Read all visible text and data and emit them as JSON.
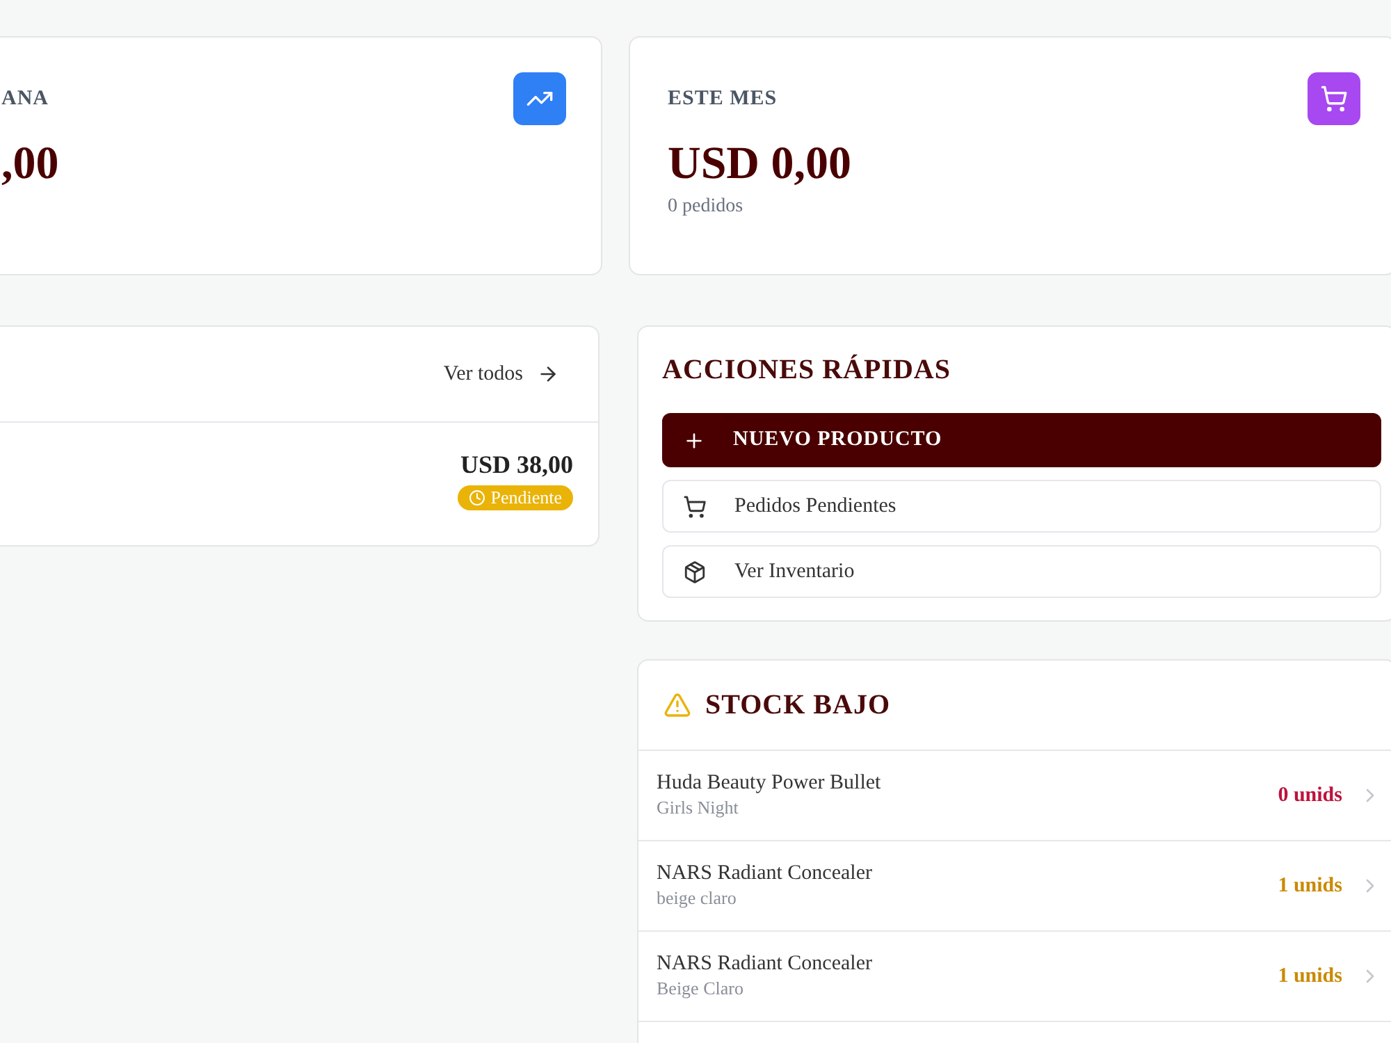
{
  "stats": [
    {
      "label": "ANA",
      "amount": ",00"
    },
    {
      "label": "ESTE MES",
      "amount": "USD 0,00",
      "note": "0 pedidos"
    }
  ],
  "recent_orders": {
    "link": "Ver todos",
    "orders": [
      {
        "total": "USD 38,00",
        "status": "Pendiente"
      }
    ]
  },
  "quick_actions": {
    "title": "ACCIONES RÁPIDAS",
    "actions": [
      {
        "label": "NUEVO PRODUCTO",
        "kind": "primary"
      },
      {
        "label": "Pedidos Pendientes",
        "kind": "secondary"
      },
      {
        "label": "Ver Inventario",
        "kind": "secondary"
      }
    ]
  },
  "low_stock": {
    "title": "STOCK BAJO",
    "items": [
      {
        "name": "Huda Beauty Power Bullet",
        "variant": "Girls Night",
        "quantity": "0 unids",
        "color": "#be123c"
      },
      {
        "name": "NARS Radiant Concealer",
        "variant": "beige claro",
        "quantity": "1 unids",
        "color": "#ca8a04"
      },
      {
        "name": "NARS Radiant Concealer",
        "variant": "Beige Claro",
        "quantity": "1 unids",
        "color": "#ca8a04"
      }
    ]
  }
}
